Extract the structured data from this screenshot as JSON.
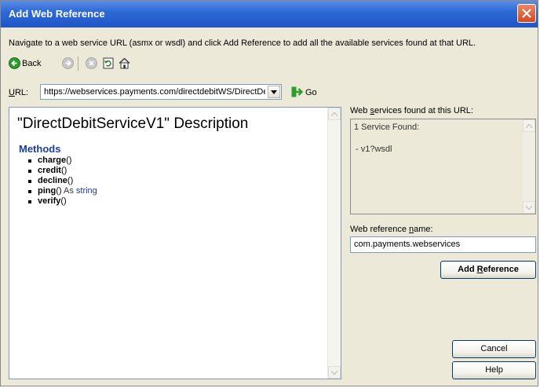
{
  "window": {
    "title": "Add Web Reference"
  },
  "instructions": "Navigate to a web service URL (asmx or wsdl) and click Add Reference to add all the available services found at that URL.",
  "toolbar": {
    "back_label": "Back",
    "icons": [
      "back-arrow-icon",
      "forward-arrow-icon",
      "stop-icon",
      "refresh-icon",
      "home-icon"
    ]
  },
  "url_bar": {
    "label_access_key": "U",
    "label_rest": "RL:",
    "value": "https://webservices.payments.com/directdebitWS/DirectDe",
    "go_label": "Go"
  },
  "description": {
    "title": "\"DirectDebitServiceV1\" Description",
    "methods_heading": "Methods",
    "methods": [
      {
        "name": "charge",
        "suffix": "()",
        "returns_label": "",
        "returns_type": ""
      },
      {
        "name": "credit",
        "suffix": "()",
        "returns_label": "",
        "returns_type": ""
      },
      {
        "name": "decline",
        "suffix": "()",
        "returns_label": "",
        "returns_type": ""
      },
      {
        "name": "ping",
        "suffix": "()",
        "returns_label": " As ",
        "returns_type": "string"
      },
      {
        "name": "verify",
        "suffix": "()",
        "returns_label": "",
        "returns_type": ""
      }
    ]
  },
  "services_found": {
    "label_pre": "Web ",
    "label_key": "s",
    "label_post": "ervices found at this URL:",
    "count_text": "1 Service Found:",
    "items": [
      "- v1?wsdl"
    ]
  },
  "web_reference": {
    "label_pre": "Web reference ",
    "label_key": "n",
    "label_post": "ame:",
    "value": "com.payments.webservices"
  },
  "buttons": {
    "add_reference_key": "R",
    "add_reference_pre": "Add ",
    "add_reference_post": "eference",
    "cancel": "Cancel",
    "help": "Help"
  },
  "colors": {
    "title_bar": "#2e69d6",
    "window_bg": "#ece9d8",
    "methods_heading": "#1a3ea2",
    "close_button": "#cf4a22"
  }
}
